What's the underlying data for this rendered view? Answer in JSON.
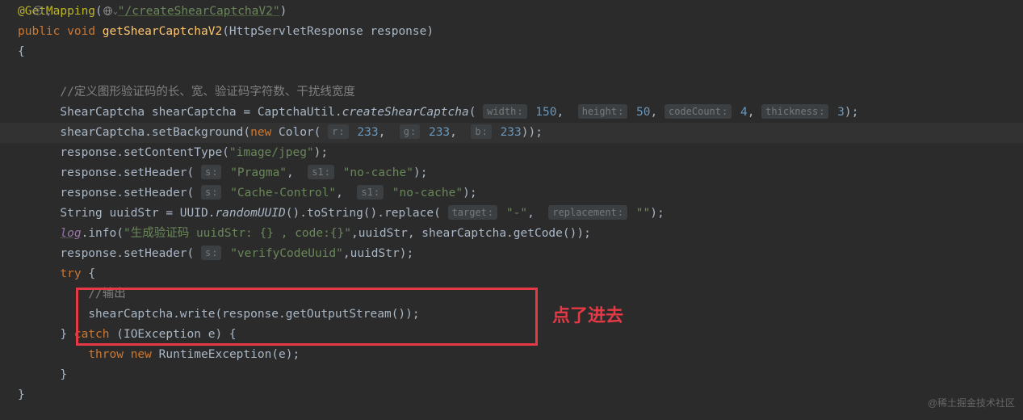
{
  "code": {
    "annotation": "@GetMapping",
    "url_path": "\"/createShearCaptchaV2\"",
    "modifier_public": "public",
    "modifier_void": "void",
    "method_name": "getShearCaptchaV2",
    "param_type": "HttpServletResponse",
    "param_name": "response",
    "brace_open": "{",
    "comment1": "//定义图形验证码的长、宽、验证码字符数、干扰线宽度",
    "line_shear_decl_a": "ShearCaptcha shearCaptcha = CaptchaUtil.",
    "create_method": "createShearCaptcha",
    "hint_width": "width",
    "val_width": "150",
    "hint_height": "height",
    "val_height": "50",
    "hint_codecount": "codeCount",
    "val_codecount": "4",
    "hint_thickness": "thickness",
    "val_thickness": "3",
    "line_setbg_a": "shearCaptcha.setBackground(",
    "kw_new": "new",
    "color_type": "Color(",
    "hint_r": "r",
    "val_r": "233",
    "hint_g": "g",
    "val_g": "233",
    "hint_b": "b",
    "val_b": "233",
    "line_ct_a": "response.setContentType(",
    "str_imagejpeg": "\"image/jpeg\"",
    "line_sh1_a": "response.setHeader(",
    "hint_s": "s",
    "str_pragma": "\"Pragma\"",
    "hint_s1": "s1",
    "str_nocache": "\"no-cache\"",
    "str_cachecontrol": "\"Cache-Control\"",
    "line_uuid_a": "String uuidStr = UUID.",
    "randomuuid": "randomUUID",
    "line_uuid_b": "().toString().replace(",
    "hint_target": "target",
    "str_dash": "\"-\"",
    "hint_replacement": "replacement",
    "str_empty": "\"\"",
    "log_ref": "log",
    "line_log_b": ".info(",
    "str_logmsg": "\"生成验证码 uuidStr: {} , code:{}\"",
    "line_log_c": ",uuidStr, shearCaptcha.getCode());",
    "str_verifycode": "\"verifyCodeUuid\"",
    "line_sh3_b": ",uuidStr);",
    "kw_try": "try",
    "comment2": "//输出",
    "line_write": "shearCaptcha.write(response.getOutputStream());",
    "kw_catch": "catch",
    "catch_type": "IOException e",
    "kw_throw": "throw",
    "runtime_type": "RuntimeException(e);",
    "brace_close": "}",
    "paren_close": ")",
    "semi": ";",
    "comma_sp": ",  "
  },
  "annotation_label": "点了进去",
  "watermark": "@稀土掘金技术社区"
}
